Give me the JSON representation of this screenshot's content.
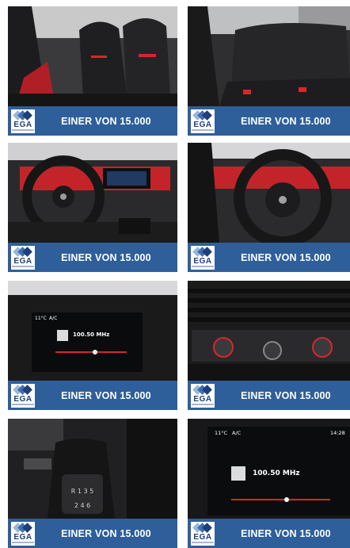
{
  "tiles": [
    {
      "name": "front-seats",
      "banner": "EINER VON 15.000",
      "logo": "EGA"
    },
    {
      "name": "rear-seats",
      "banner": "EINER VON 15.000",
      "logo": "EGA"
    },
    {
      "name": "dashboard-steering-wheel",
      "banner": "EINER VON 15.000",
      "logo": "EGA"
    },
    {
      "name": "steering-wheel-closeup",
      "banner": "EINER VON 15.000",
      "logo": "EGA"
    },
    {
      "name": "infotainment-radio",
      "banner": "EINER VON 15.000",
      "logo": "EGA",
      "screen": {
        "temp": "11°C",
        "ac": "A/C",
        "frequency": "100.50 MHz"
      }
    },
    {
      "name": "climate-controls",
      "banner": "EINER VON 15.000",
      "logo": "EGA"
    },
    {
      "name": "gear-shifter",
      "banner": "EINER VON 15.000",
      "logo": "EGA"
    },
    {
      "name": "infotainment-radio-closeup",
      "banner": "EINER VON 15.000",
      "logo": "EGA",
      "screen": {
        "temp": "11°C",
        "ac": "A/C",
        "frequency": "100.50 MHz",
        "time": "14:28"
      }
    }
  ],
  "colors": {
    "banner": "#2f5f9a",
    "accent_red": "#d8262c",
    "logo_dark": "#1e3f77"
  }
}
